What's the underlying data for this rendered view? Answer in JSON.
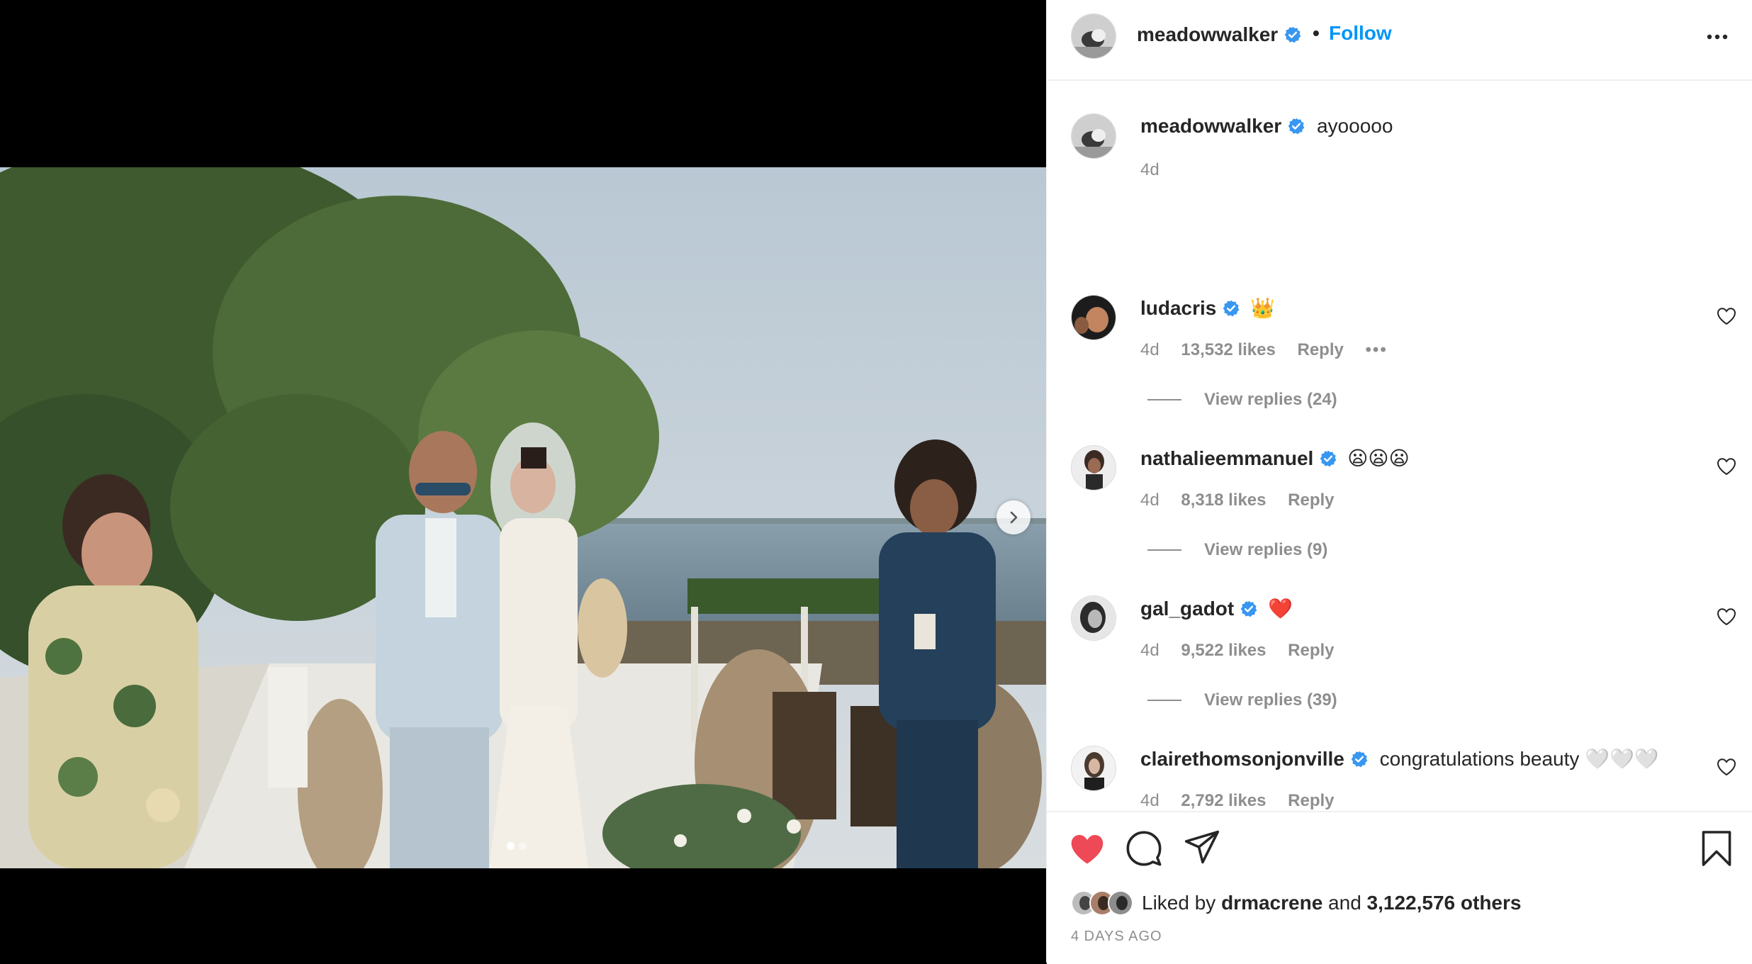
{
  "post": {
    "username": "meadowwalker",
    "separator": "•",
    "follow_label": "Follow",
    "carousel": {
      "slides": 2,
      "active": 1
    }
  },
  "caption": {
    "username": "meadowwalker",
    "text": "ayooooo",
    "time": "4d"
  },
  "comments": [
    {
      "username": "ludacris",
      "text": "👑",
      "time": "4d",
      "likes": "13,532 likes",
      "reply": "Reply",
      "more": "•••",
      "view_replies": "View replies (24)"
    },
    {
      "username": "nathalieemmanuel",
      "text": "😦😦😦",
      "time": "4d",
      "likes": "8,318 likes",
      "reply": "Reply",
      "view_replies": "View replies (9)"
    },
    {
      "username": "gal_gadot",
      "text": "❤️",
      "time": "4d",
      "likes": "9,522 likes",
      "reply": "Reply",
      "view_replies": "View replies (39)"
    },
    {
      "username": "clairethomsonjonville",
      "text": "congratulations beauty 🤍🤍🤍",
      "time": "4d",
      "likes": "2,792 likes",
      "reply": "Reply"
    }
  ],
  "likes": {
    "prefix": "Liked by",
    "user": "drmacrene",
    "conj": "and",
    "others": "3,122,576 others"
  },
  "date": "4 DAYS AGO",
  "colors": {
    "accent": "#0095f6",
    "liked": "#ed4956",
    "verified": "#3897f0"
  },
  "icons": [
    "verified-badge-icon",
    "more-options-icon",
    "chevron-right-icon",
    "heart-outline-icon",
    "heart-filled-icon",
    "comment-icon",
    "share-icon",
    "bookmark-icon"
  ]
}
